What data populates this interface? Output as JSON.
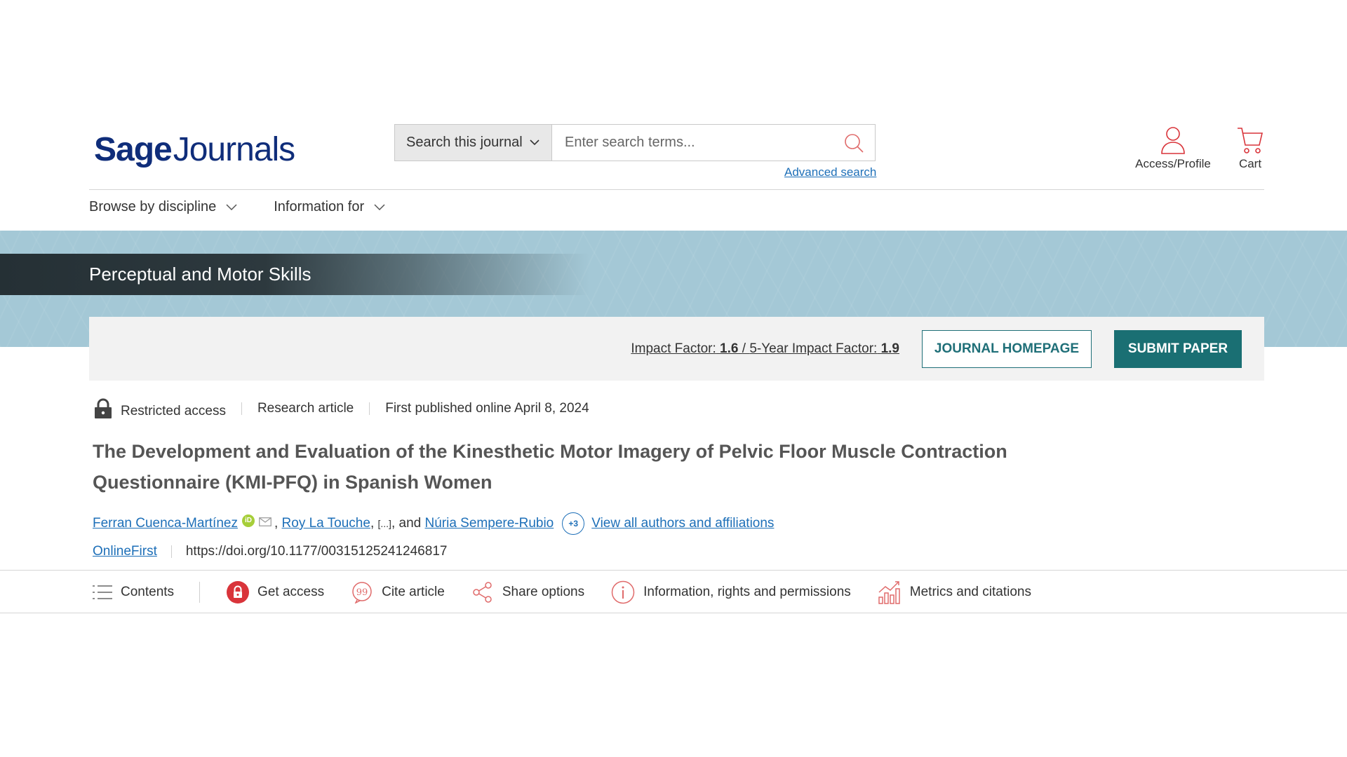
{
  "header": {
    "logo_bold": "Sage",
    "logo_rest": "Journals",
    "search_scope": "Search this journal",
    "search_placeholder": "Enter search terms...",
    "advanced_search": "Advanced search",
    "access_label": "Access/Profile",
    "cart_label": "Cart"
  },
  "nav": {
    "items": [
      {
        "label": "Browse by discipline"
      },
      {
        "label": "Information for"
      }
    ]
  },
  "journal": {
    "name": "Perceptual and Motor Skills",
    "impact_label": "Impact Factor:",
    "impact_value": "1.6",
    "five_year_label": "5-Year Impact Factor:",
    "five_year_value": "1.9",
    "homepage_button": "JOURNAL HOMEPAGE",
    "submit_button": "SUBMIT PAPER"
  },
  "article": {
    "access": "Restricted access",
    "type": "Research article",
    "published": "First published online April 8, 2024",
    "title": "The Development and Evaluation of the Kinesthetic Motor Imagery of Pelvic Floor Muscle Contraction Questionnaire (KMI-PFQ) in Spanish Women",
    "author1": "Ferran Cuenca-Martínez",
    "author2": "Roy La Touche",
    "ellipsis": "[...]",
    "and": "and",
    "author3": "Núria Sempere-Rubio",
    "more_count": "+3",
    "view_all": "View all authors and affiliations",
    "issue": "OnlineFirst",
    "doi": "https://doi.org/10.1177/00315125241246817"
  },
  "toolbar": {
    "contents": "Contents",
    "get_access": "Get access",
    "cite": "Cite article",
    "share": "Share options",
    "info": "Information, rights and permissions",
    "metrics": "Metrics and citations"
  },
  "colors": {
    "brand": "#0f2d7a",
    "link": "#1d6fb8",
    "teal": "#1a6f73",
    "accent_red": "#d9343a",
    "banner": "#a4c8d6"
  }
}
